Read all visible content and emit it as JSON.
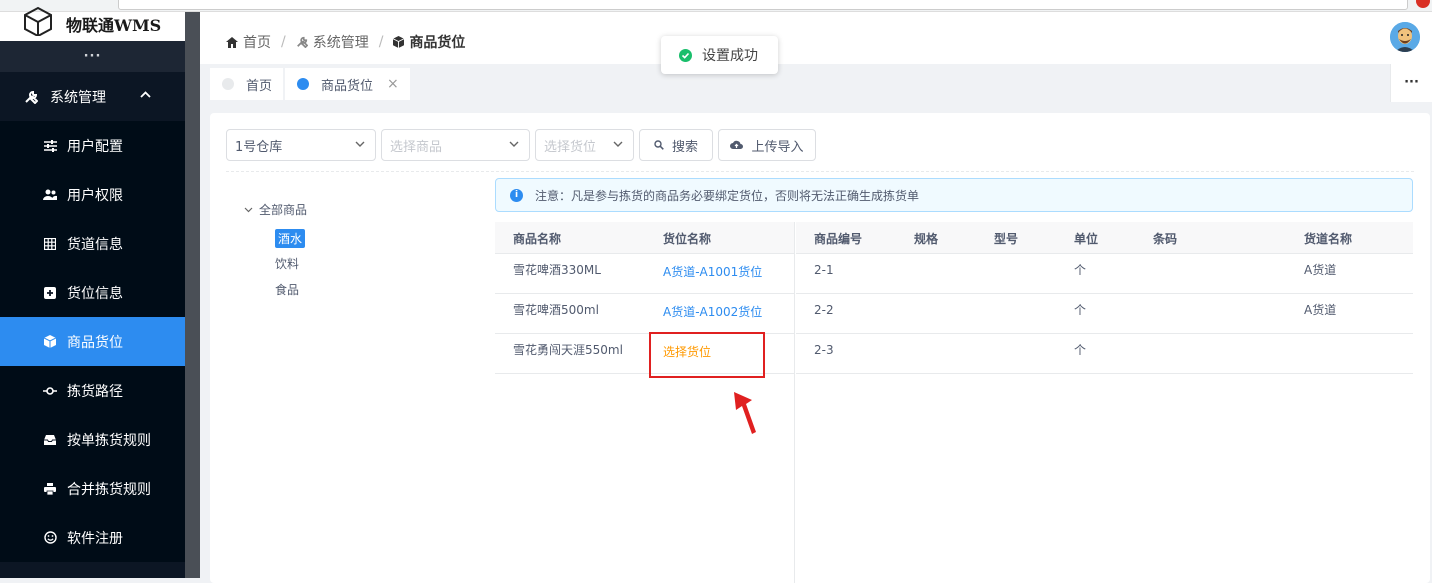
{
  "app": {
    "logo_text": "物联通WMS",
    "more_dots": "···"
  },
  "sidebar": {
    "group": {
      "label": "系统管理",
      "icon": "tools-icon"
    },
    "items": [
      {
        "label": "用户配置",
        "icon": "sliders-icon",
        "active": false
      },
      {
        "label": "用户权限",
        "icon": "users-icon",
        "active": false
      },
      {
        "label": "货道信息",
        "icon": "grid-icon",
        "active": false
      },
      {
        "label": "货位信息",
        "icon": "plus-box-icon",
        "active": false
      },
      {
        "label": "商品货位",
        "icon": "cube-icon",
        "active": true
      },
      {
        "label": "拣货路径",
        "icon": "route-icon",
        "active": false
      },
      {
        "label": "按单拣货规则",
        "icon": "inbox-icon",
        "active": false
      },
      {
        "label": "合并拣货规则",
        "icon": "printer-icon",
        "active": false
      },
      {
        "label": "软件注册",
        "icon": "smile-icon",
        "active": false
      }
    ]
  },
  "breadcrumb": {
    "home": "首页",
    "section": "系统管理",
    "current": "商品货位"
  },
  "toast": {
    "message": "设置成功"
  },
  "tabs": [
    {
      "label": "首页",
      "active": false
    },
    {
      "label": "商品货位",
      "active": true,
      "close": "×"
    }
  ],
  "tab_more": "···",
  "filters": {
    "warehouse": "1号仓库",
    "product_placeholder": "选择商品",
    "location_placeholder": "选择货位",
    "search_label": "搜索",
    "upload_label": "上传导入"
  },
  "tree": {
    "root": "全部商品",
    "children": [
      {
        "label": "酒水",
        "selected": true
      },
      {
        "label": "饮料",
        "selected": false
      },
      {
        "label": "食品",
        "selected": false
      }
    ]
  },
  "notice": "注意：凡是参与拣货的商品务必要绑定货位，否则将无法正确生成拣货单",
  "left_table": {
    "columns": [
      "商品名称",
      "货位名称"
    ],
    "rows": [
      {
        "name": "雪花啤酒330ML",
        "location": "A货道-A1001货位",
        "location_set": true
      },
      {
        "name": "雪花啤酒500ml",
        "location": "A货道-A1002货位",
        "location_set": true
      },
      {
        "name": "雪花勇闯天涯550ml",
        "location": "选择货位",
        "location_set": false
      }
    ]
  },
  "right_table": {
    "columns": [
      "商品编号",
      "规格",
      "型号",
      "单位",
      "条码",
      "货道名称"
    ],
    "rows": [
      {
        "code": "2-1",
        "spec": "",
        "model": "",
        "unit": "个",
        "barcode": "",
        "aisle": "A货道"
      },
      {
        "code": "2-2",
        "spec": "",
        "model": "",
        "unit": "个",
        "barcode": "",
        "aisle": "A货道"
      },
      {
        "code": "2-3",
        "spec": "",
        "model": "",
        "unit": "个",
        "barcode": "",
        "aisle": ""
      }
    ]
  },
  "colors": {
    "sidebar_bg": "#0c1624",
    "active": "#2d8cf0",
    "success": "#19be6b",
    "warning": "#ff9900",
    "annotation_red": "#e02020"
  }
}
